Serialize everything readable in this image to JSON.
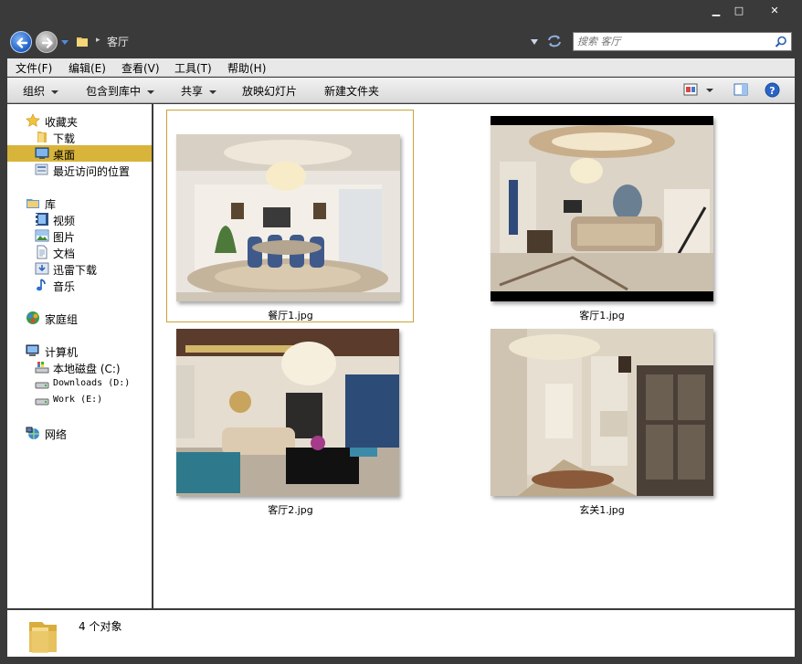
{
  "window": {
    "minimize_glyph": "▁",
    "maximize_glyph": "□",
    "close_glyph": "✕"
  },
  "address": {
    "crumb": "客厅",
    "search_placeholder": "搜索 客厅"
  },
  "menu": [
    "文件(F)",
    "编辑(E)",
    "查看(V)",
    "工具(T)",
    "帮助(H)"
  ],
  "commands": {
    "organize": "组织",
    "include_library": "包含到库中",
    "share": "共享",
    "slideshow": "放映幻灯片",
    "new_folder": "新建文件夹"
  },
  "nav": {
    "favorites": "收藏夹",
    "downloads": "下载",
    "desktop": "桌面",
    "recent": "最近访问的位置",
    "libraries": "库",
    "videos": "视频",
    "pictures": "图片",
    "documents": "文档",
    "xunlei": "迅雷下载",
    "music": "音乐",
    "homegroup": "家庭组",
    "computer": "计算机",
    "drive_c": "本地磁盘 (C:)",
    "drive_d": "Downloads (D:)",
    "drive_e": "Work (E:)",
    "network": "网络"
  },
  "files": [
    {
      "name": "餐厅1.jpg",
      "selected": true
    },
    {
      "name": "客厅1.jpg",
      "selected": false
    },
    {
      "name": "客厅2.jpg",
      "selected": false
    },
    {
      "name": "玄关1.jpg",
      "selected": false
    }
  ],
  "status": {
    "count_text": "4 个对象"
  },
  "colors": {
    "selection_accent": "#d8b43a",
    "window_frame": "#3a3a3a"
  }
}
